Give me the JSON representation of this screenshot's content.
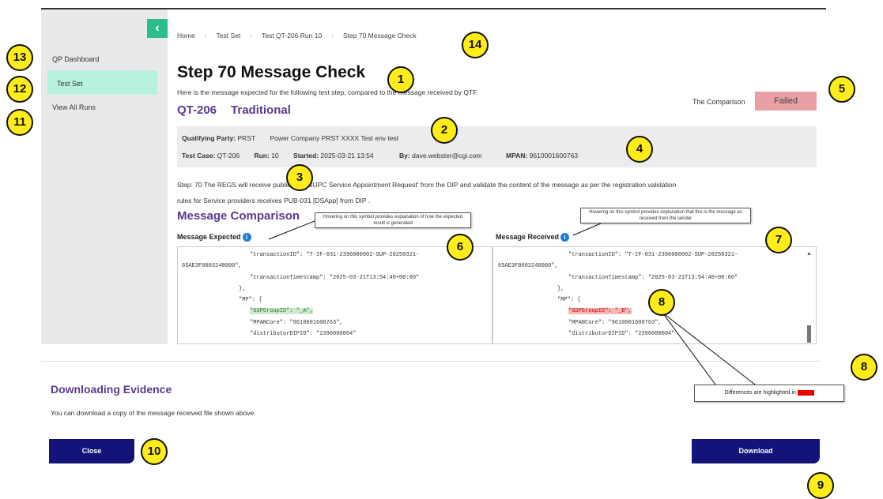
{
  "sidebar": {
    "collapse_icon": "chevron-left-icon",
    "items": [
      {
        "label": "QP Dashboard"
      },
      {
        "label": "Test Set"
      },
      {
        "label": "View All Runs"
      }
    ]
  },
  "breadcrumb": [
    "Home",
    "Test Set",
    "Test QT-206 Run 10",
    "Step 70 Message Check"
  ],
  "page": {
    "title": "Step 70 Message Check",
    "subtitle": "Here is the message expected for the following test step, compared to the message received by QTF.",
    "qt_id": "QT-206",
    "qt_type": "Traditional",
    "comparison_label": "The Comparison",
    "comparison_status": "Failed"
  },
  "info": {
    "qp_label": "Qualifying Party:",
    "qp_value": "PRST",
    "qp_name": "Power Company PRST XXXX Test env test",
    "test_case_label": "Test Case:",
    "test_case_value": "QT-206",
    "run_label": "Run:",
    "run_value": "10",
    "started_label": "Started:",
    "started_value": "2025-03-21 13:54",
    "by_label": "By:",
    "by_value": "dave.webster@cgi.com",
    "mpan_label": "MPAN:",
    "mpan_value": "9610001600763"
  },
  "step": {
    "line1": "Step: 70     The REGS will receive publication 'SUPC Service Appointment Request' from the DIP and validate the content of the message as per the registration validation",
    "line2": "rules for Service providers receives PUB-031 [DSApp] from DIP ."
  },
  "comparison": {
    "title": "Message Comparison",
    "expected_label": "Message Expected",
    "received_label": "Message Received",
    "expected_tip": "Hovering on this symbol provides explanation of how the expected result is generated",
    "received_tip": "Hovering on this symbol provides explanation that this is the message as received from the sender",
    "expected_lines": [
      "\"transactionID\": \"T-IF-031-2396000002-SUP-20250321-",
      "65AE3F0003248000\",",
      "\"transactionTimestamp\": \"2025-03-21T13:54:40+00:00\"",
      "},",
      "\"MP\": {",
      "\"GSPGroupID\": \"_A\",",
      "\"MPANCore\": \"9610001600763\",",
      "\"distributorDIPID\": \"2396000004\""
    ],
    "received_lines": [
      "\"transactionID\": \"T-IF-031-2396000002-SUP-20250321-",
      "65AE3F0003248000\",",
      "\"transactionTimestamp\": \"2025-03-21T13:54:40+00:00\"",
      "},",
      "\"MP\": {",
      "\"GSPGroupID\": \"_B\",",
      "\"MPANCore\": \"9610001600763\",",
      "\"distributorDIPID\": \"2396000004\""
    ],
    "diff_note_prefix": "Differences are highlighted in",
    "diff_note_color": "RED"
  },
  "download": {
    "title": "Downloading Evidence",
    "text": "You can download a copy of the message received file shown above.",
    "close_label": "Close",
    "download_label": "Download"
  },
  "callouts": [
    "1",
    "2",
    "3",
    "4",
    "5",
    "6",
    "7",
    "8",
    "8",
    "9",
    "10",
    "11",
    "12",
    "13",
    "14"
  ],
  "colors": {
    "accent_purple": "#5b3a8e",
    "button_navy": "#14137a",
    "failed_badge": "#e8a0a4",
    "sidebar_active": "#b8f0e0",
    "collapse_green": "#2bbd8b",
    "callout_yellow": "#ffec1a"
  }
}
